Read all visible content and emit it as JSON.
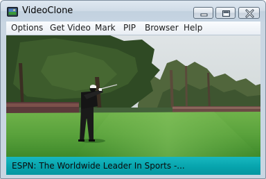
{
  "window": {
    "title": "VideoClone",
    "controls": {
      "minimize": "minimize-icon",
      "maximize": "maximize-icon",
      "close": "close-icon"
    }
  },
  "menubar": {
    "items": [
      {
        "label": "Options"
      },
      {
        "label": "Get Video"
      },
      {
        "label": "Mark"
      },
      {
        "label": "PIP"
      },
      {
        "label": "Browser"
      },
      {
        "label": "Help"
      }
    ]
  },
  "video": {
    "scene": "golf-swing-video-frame"
  },
  "status": {
    "text": "ESPN: The Worldwide Leader In Sports -..."
  },
  "colors": {
    "status_bar": "#0aa6ae",
    "titlebar": "#c9d6e2",
    "close_x": "#c0392b"
  }
}
